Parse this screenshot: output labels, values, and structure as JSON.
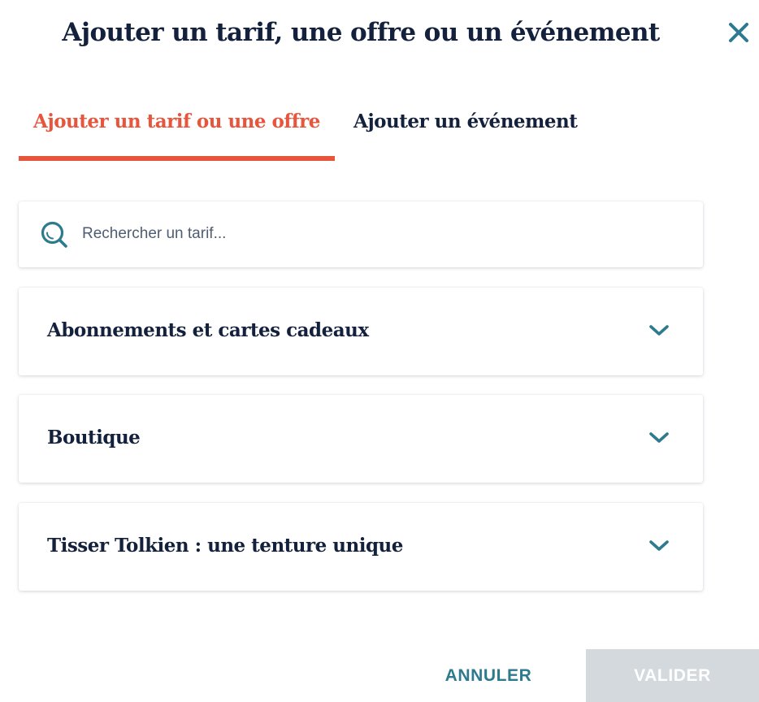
{
  "dialog": {
    "title": "Ajouter un tarif, une offre ou un événement",
    "close_icon": "close-icon"
  },
  "tabs": [
    {
      "label": "Ajouter un tarif ou une offre",
      "active": true
    },
    {
      "label": "Ajouter un événement",
      "active": false
    }
  ],
  "search": {
    "placeholder": "Rechercher un tarif...",
    "value": "",
    "icon": "search-icon"
  },
  "categories": [
    {
      "label": "Abonnements et cartes cadeaux",
      "icon": "chevron-down-icon",
      "expanded": false
    },
    {
      "label": "Boutique",
      "icon": "chevron-down-icon",
      "expanded": false
    },
    {
      "label": "Tisser Tolkien : une tenture unique",
      "icon": "chevron-down-icon",
      "expanded": false
    }
  ],
  "footer": {
    "cancel_label": "ANNULER",
    "validate_label": "VALIDER",
    "validate_disabled": true
  },
  "colors": {
    "accent": "#e8553d",
    "teal": "#2e7a8f",
    "navy": "#14213d",
    "disabled": "#d4d9de"
  }
}
